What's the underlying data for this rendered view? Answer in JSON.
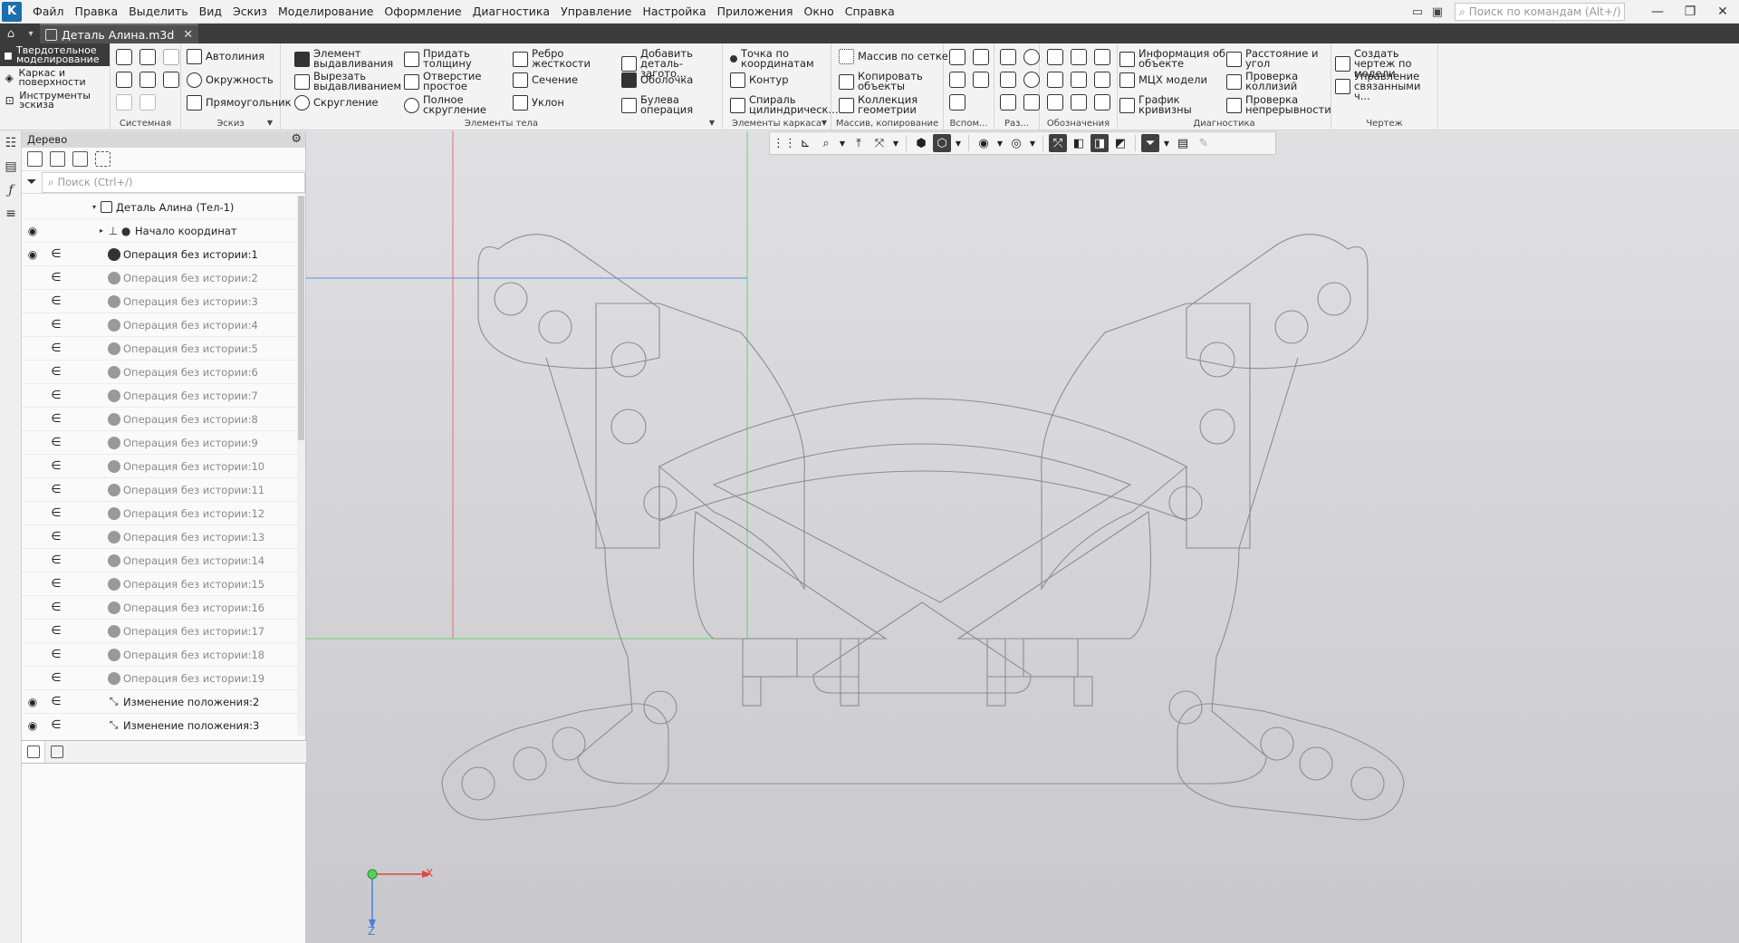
{
  "menu": {
    "items": [
      "Файл",
      "Правка",
      "Выделить",
      "Вид",
      "Эскиз",
      "Моделирование",
      "Оформление",
      "Диагностика",
      "Управление",
      "Настройка",
      "Приложения",
      "Окно",
      "Справка"
    ],
    "search_placeholder": "Поиск по командам (Alt+/)"
  },
  "document_tab": {
    "label": "Деталь Алина.m3d"
  },
  "mode_panel": {
    "items": [
      {
        "label": "Твердотельное моделирование",
        "active": true
      },
      {
        "label": "Каркас и поверхности",
        "active": false
      },
      {
        "label": "Инструменты эскиза",
        "active": false
      }
    ]
  },
  "ribbon": {
    "groups": {
      "system": "Системная",
      "sketch": "Эскиз",
      "body_elements": "Элементы тела",
      "wireframe": "Элементы каркаса",
      "arrays": "Массив, копирование",
      "aux": "Вспом...",
      "dims": "Раз...",
      "designations": "Обозначения",
      "diagnostics": "Диагностика",
      "drawing": "Чертеж"
    },
    "sketch_buttons": [
      "Автолиния",
      "Окружность",
      "Прямоугольник"
    ],
    "body_buttons": {
      "extrude": "Элемент выдавливания",
      "cut_extrude": "Вырезать выдавливанием",
      "fillet": "Скругление",
      "thicken": "Придать толщину",
      "hole": "Отверстие простое",
      "full_round": "Полное скругление",
      "rib": "Ребро жесткости",
      "section": "Сечение",
      "draft": "Уклон",
      "add_stock": "Добавить деталь-загото...",
      "shell": "Оболочка",
      "boolean": "Булева операция"
    },
    "wireframe_buttons": {
      "point": "Точка по координатам",
      "contour": "Контур",
      "spiral": "Спираль цилиндрическ..."
    },
    "array_buttons": {
      "grid": "Массив по сетке",
      "copy": "Копировать объекты",
      "collection": "Коллекция геометрии"
    },
    "diagnostic_buttons": {
      "info": "Информация об объекте",
      "mcx": "МЦХ модели",
      "curvature": "График кривизны",
      "distance": "Расстояние и угол",
      "collisions": "Проверка коллизий",
      "continuity": "Проверка непрерывности"
    },
    "drawing_buttons": {
      "create": "Создать чертеж по модели",
      "manage": "Управление связанными ч..."
    }
  },
  "tree": {
    "title": "Дерево",
    "search_placeholder": "Поиск (Ctrl+/)",
    "rows": [
      {
        "label": "Деталь Алина (Тел-1)",
        "level": 0,
        "expander": "▾",
        "eye": false,
        "ref": false,
        "icon": "part",
        "dim": false
      },
      {
        "label": "Начало координат",
        "level": 1,
        "expander": "▸",
        "eye": true,
        "ref": false,
        "icon": "origin",
        "dim": false
      },
      {
        "label": "Операция без истории:1",
        "level": 1,
        "expander": "",
        "eye": true,
        "ref": true,
        "icon": "op-active",
        "dim": false
      },
      {
        "label": "Операция без истории:2",
        "level": 1,
        "expander": "",
        "eye": false,
        "ref": true,
        "icon": "op",
        "dim": true
      },
      {
        "label": "Операция без истории:3",
        "level": 1,
        "expander": "",
        "eye": false,
        "ref": true,
        "icon": "op",
        "dim": true
      },
      {
        "label": "Операция без истории:4",
        "level": 1,
        "expander": "",
        "eye": false,
        "ref": true,
        "icon": "op",
        "dim": true
      },
      {
        "label": "Операция без истории:5",
        "level": 1,
        "expander": "",
        "eye": false,
        "ref": true,
        "icon": "op",
        "dim": true
      },
      {
        "label": "Операция без истории:6",
        "level": 1,
        "expander": "",
        "eye": false,
        "ref": true,
        "icon": "op",
        "dim": true
      },
      {
        "label": "Операция без истории:7",
        "level": 1,
        "expander": "",
        "eye": false,
        "ref": true,
        "icon": "op",
        "dim": true
      },
      {
        "label": "Операция без истории:8",
        "level": 1,
        "expander": "",
        "eye": false,
        "ref": true,
        "icon": "op",
        "dim": true
      },
      {
        "label": "Операция без истории:9",
        "level": 1,
        "expander": "",
        "eye": false,
        "ref": true,
        "icon": "op",
        "dim": true
      },
      {
        "label": "Операция без истории:10",
        "level": 1,
        "expander": "",
        "eye": false,
        "ref": true,
        "icon": "op",
        "dim": true
      },
      {
        "label": "Операция без истории:11",
        "level": 1,
        "expander": "",
        "eye": false,
        "ref": true,
        "icon": "op",
        "dim": true
      },
      {
        "label": "Операция без истории:12",
        "level": 1,
        "expander": "",
        "eye": false,
        "ref": true,
        "icon": "op",
        "dim": true
      },
      {
        "label": "Операция без истории:13",
        "level": 1,
        "expander": "",
        "eye": false,
        "ref": true,
        "icon": "op",
        "dim": true
      },
      {
        "label": "Операция без истории:14",
        "level": 1,
        "expander": "",
        "eye": false,
        "ref": true,
        "icon": "op",
        "dim": true
      },
      {
        "label": "Операция без истории:15",
        "level": 1,
        "expander": "",
        "eye": false,
        "ref": true,
        "icon": "op",
        "dim": true
      },
      {
        "label": "Операция без истории:16",
        "level": 1,
        "expander": "",
        "eye": false,
        "ref": true,
        "icon": "op",
        "dim": true
      },
      {
        "label": "Операция без истории:17",
        "level": 1,
        "expander": "",
        "eye": false,
        "ref": true,
        "icon": "op",
        "dim": true
      },
      {
        "label": "Операция без истории:18",
        "level": 1,
        "expander": "",
        "eye": false,
        "ref": true,
        "icon": "op",
        "dim": true
      },
      {
        "label": "Операция без истории:19",
        "level": 1,
        "expander": "",
        "eye": false,
        "ref": true,
        "icon": "op",
        "dim": true
      },
      {
        "label": "Изменение положения:2",
        "level": 1,
        "expander": "",
        "eye": true,
        "ref": true,
        "icon": "move",
        "dim": false
      },
      {
        "label": "Изменение положения:3",
        "level": 1,
        "expander": "",
        "eye": true,
        "ref": true,
        "icon": "move",
        "dim": false
      }
    ]
  },
  "axes": {
    "x_label": "X",
    "z_label": "Z"
  },
  "colors": {
    "accent": "#1a6fb0",
    "axis_x": "#e04545",
    "axis_y": "#5ad05a",
    "axis_z": "#4a7fd6",
    "part_lines": "#8d8d92"
  }
}
